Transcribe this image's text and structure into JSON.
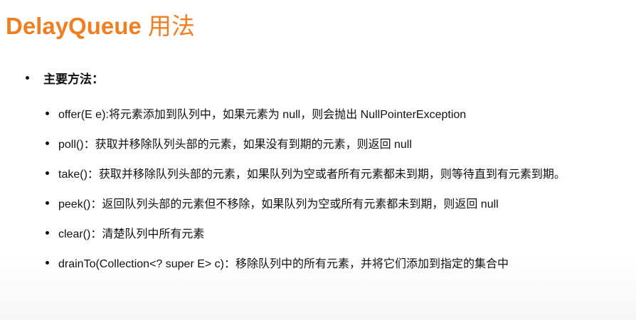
{
  "title": {
    "latin": "DelayQueue",
    "cjk": " 用法"
  },
  "section": {
    "label": "主要方法："
  },
  "methods": [
    {
      "text": "offer(E e):将元素添加到队列中，如果元素为 null，则会抛出 NullPointerException"
    },
    {
      "text": "poll()：获取并移除队列头部的元素，如果没有到期的元素，则返回 null"
    },
    {
      "text": "take()：获取并移除队列头部的元素，如果队列为空或者所有元素都未到期，则等待直到有元素到期。"
    },
    {
      "text": "peek()：返回队列头部的元素但不移除，如果队列为空或所有元素都未到期，则返回 null"
    },
    {
      "text": "clear()：清楚队列中所有元素"
    },
    {
      "text": "drainTo(Collection<? super E> c)：移除队列中的所有元素，并将它们添加到指定的集合中"
    }
  ],
  "colors": {
    "title": "#f07f22",
    "text": "#111111",
    "background": "#ffffff"
  }
}
